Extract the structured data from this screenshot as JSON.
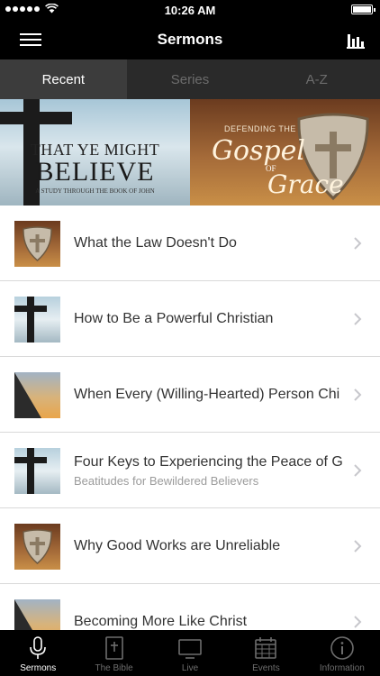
{
  "status_bar": {
    "time": "10:26 AM"
  },
  "nav": {
    "title": "Sermons"
  },
  "tabs": [
    {
      "label": "Recent",
      "active": true
    },
    {
      "label": "Series",
      "active": false
    },
    {
      "label": "A-Z",
      "active": false
    }
  ],
  "banners": {
    "left": {
      "line1": "THAT YE MIGHT",
      "line2": "BELIEVE",
      "line3": "A STUDY THROUGH THE BOOK OF JOHN"
    },
    "right": {
      "line1": "DEFENDING THE",
      "line2": "Gospel",
      "line3": "OF",
      "line4": "Grace"
    }
  },
  "sermons": [
    {
      "title": "What the Law Doesn't Do",
      "subtitle": "",
      "thumb": "shield"
    },
    {
      "title": "How to Be a Powerful Christian",
      "subtitle": "",
      "thumb": "cross"
    },
    {
      "title": "When Every (Willing-Hearted) Person Chi",
      "subtitle": "",
      "thumb": "sunset"
    },
    {
      "title": "Four Keys to Experiencing the Peace of G",
      "subtitle": "Beatitudes for Bewildered Believers",
      "thumb": "cross"
    },
    {
      "title": "Why Good Works are Unreliable",
      "subtitle": "",
      "thumb": "shield"
    },
    {
      "title": "Becoming More Like Christ",
      "subtitle": "",
      "thumb": "sunset"
    }
  ],
  "tab_bar": [
    {
      "label": "Sermons",
      "icon": "microphone-icon",
      "active": true
    },
    {
      "label": "The Bible",
      "icon": "bible-icon",
      "active": false
    },
    {
      "label": "Live",
      "icon": "tv-icon",
      "active": false
    },
    {
      "label": "Events",
      "icon": "calendar-icon",
      "active": false
    },
    {
      "label": "Information",
      "icon": "info-icon",
      "active": false
    }
  ],
  "colors": {
    "bar_bg": "#000000",
    "tab_bg": "#2a2a2a",
    "tab_active_bg": "#3c3c3c",
    "title_text": "#333333",
    "subtitle_text": "#9b9b9b"
  }
}
